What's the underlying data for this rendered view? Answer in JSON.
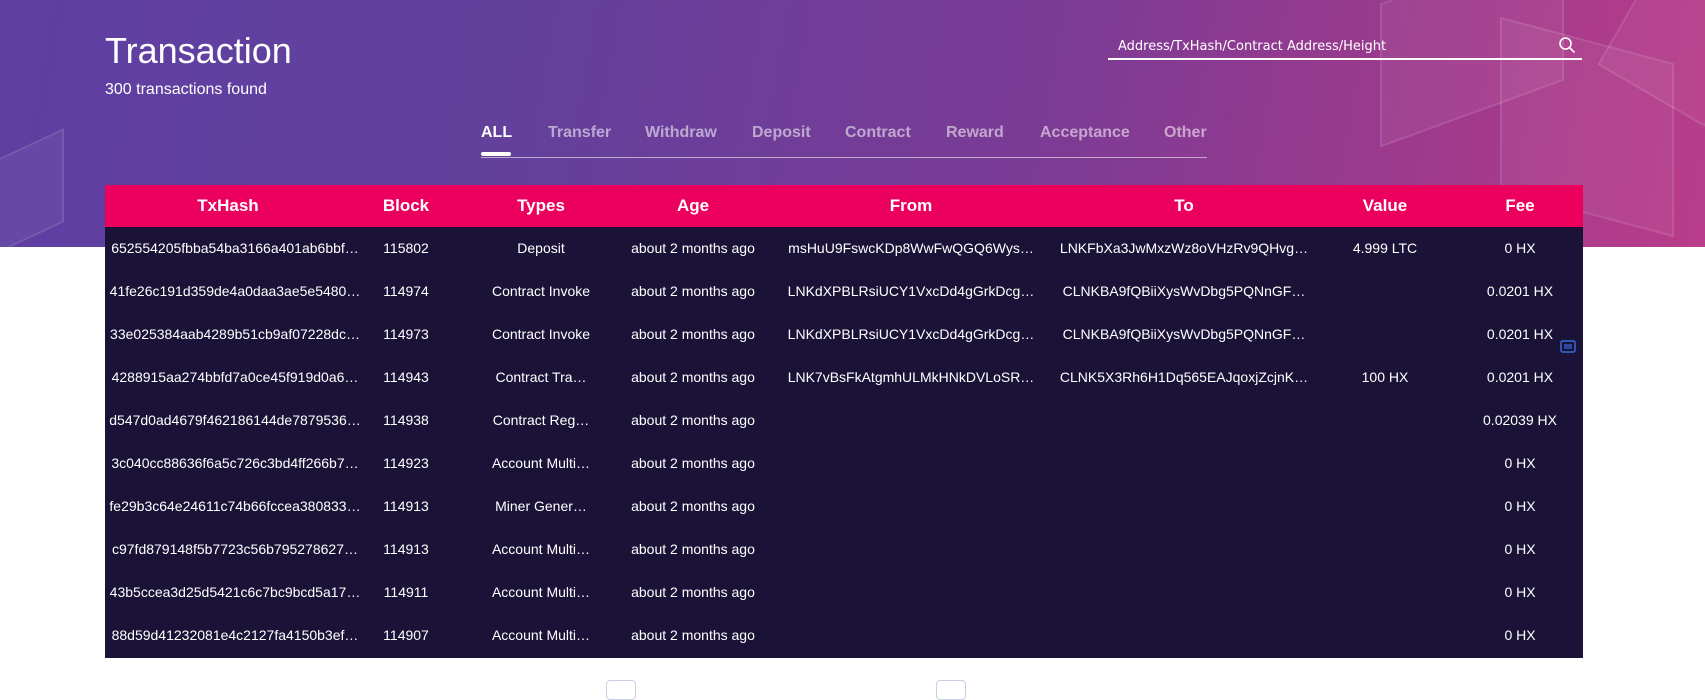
{
  "header": {
    "title": "Transaction",
    "subtitle": "300 transactions found",
    "search_placeholder": "Address/TxHash/Contract Address/Height",
    "search_icon": "search-icon"
  },
  "tabs": [
    {
      "label": "ALL",
      "active": true
    },
    {
      "label": "Transfer",
      "active": false
    },
    {
      "label": "Withdraw",
      "active": false
    },
    {
      "label": "Deposit",
      "active": false
    },
    {
      "label": "Contract",
      "active": false
    },
    {
      "label": "Reward",
      "active": false
    },
    {
      "label": "Acceptance",
      "active": false
    },
    {
      "label": "Other",
      "active": false
    }
  ],
  "table": {
    "columns": [
      "TxHash",
      "Block",
      "Types",
      "Age",
      "From",
      "To",
      "Value",
      "Fee"
    ],
    "rows": [
      [
        "652554205fbba54ba3166a401ab6bbf…",
        "115802",
        "Deposit",
        "about 2 months ago",
        "msHuU9FswcKDp8WwFwQGQ6Wys…",
        "LNKFbXa3JwMxzWz8oVHzRv9QHvg…",
        "4.999 LTC",
        "0 HX"
      ],
      [
        "41fe26c191d359de4a0daa3ae5e5480…",
        "114974",
        "Contract Invoke",
        "about 2 months ago",
        "LNKdXPBLRsiUCY1VxcDd4gGrkDcg…",
        "CLNKBA9fQBiiXysWvDbg5PQNnGF…",
        "",
        "0.0201 HX"
      ],
      [
        "33e025384aab4289b51cb9af07228dc…",
        "114973",
        "Contract Invoke",
        "about 2 months ago",
        "LNKdXPBLRsiUCY1VxcDd4gGrkDcg…",
        "CLNKBA9fQBiiXysWvDbg5PQNnGF…",
        "",
        "0.0201 HX"
      ],
      [
        "4288915aa274bbfd7a0ce45f919d0a6…",
        "114943",
        "Contract Tra…",
        "about 2 months ago",
        "LNK7vBsFkAtgmhULMkHNkDVLoSR…",
        "CLNK5X3Rh6H1Dq565EAJqoxjZcjnK…",
        "100 HX",
        "0.0201 HX"
      ],
      [
        "d547d0ad4679f462186144de7879536…",
        "114938",
        "Contract Reg…",
        "about 2 months ago",
        "",
        "",
        "",
        "0.02039 HX"
      ],
      [
        "3c040cc88636f6a5c726c3bd4ff266b7…",
        "114923",
        "Account Multi…",
        "about 2 months ago",
        "",
        "",
        "",
        "0 HX"
      ],
      [
        "fe29b3c64e24611c74b66fccea380833…",
        "114913",
        "Miner Gener…",
        "about 2 months ago",
        "",
        "",
        "",
        "0 HX"
      ],
      [
        "c97fd879148f5b7723c56b795278627…",
        "114913",
        "Account Multi…",
        "about 2 months ago",
        "",
        "",
        "",
        "0 HX"
      ],
      [
        "43b5ccea3d25d5421c6c7bc9bcd5a17…",
        "114911",
        "Account Multi…",
        "about 2 months ago",
        "",
        "",
        "",
        "0 HX"
      ],
      [
        "88d59d41232081e4c2127fa4150b3ef…",
        "114907",
        "Account Multi…",
        "about 2 months ago",
        "",
        "",
        "",
        "0 HX"
      ]
    ]
  },
  "colors": {
    "header_row": "#ec005e",
    "table_bg": "#1b1237",
    "hero_start": "#5e3fa2",
    "hero_end": "#b93d8a"
  }
}
